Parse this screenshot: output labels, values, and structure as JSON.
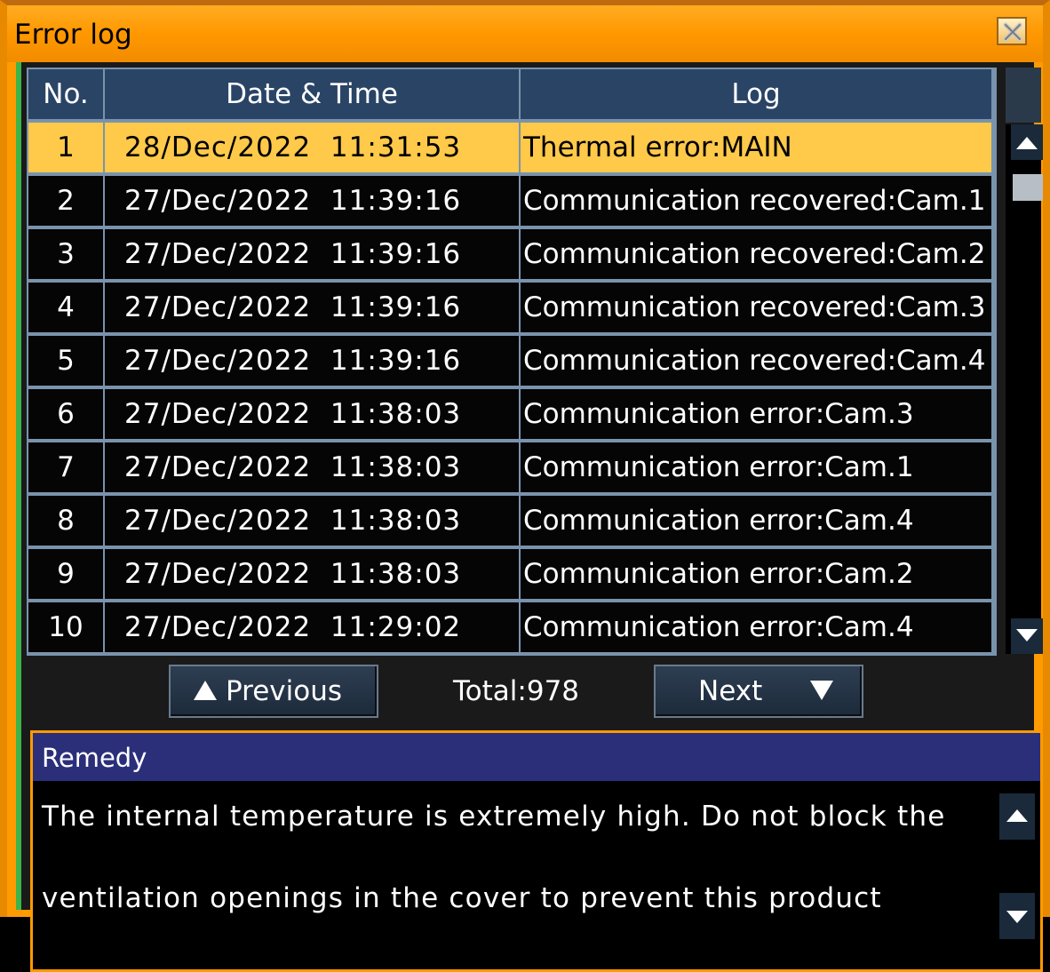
{
  "window": {
    "title": "Error log"
  },
  "table": {
    "headers": {
      "no": "No.",
      "datetime": "Date & Time",
      "log": "Log"
    },
    "rows": [
      {
        "no": "1",
        "datetime": "28/Dec/2022  11:31:53",
        "log": "Thermal error:MAIN",
        "selected": true
      },
      {
        "no": "2",
        "datetime": "27/Dec/2022  11:39:16",
        "log": "Communication recovered:Cam.1"
      },
      {
        "no": "3",
        "datetime": "27/Dec/2022  11:39:16",
        "log": "Communication recovered:Cam.2"
      },
      {
        "no": "4",
        "datetime": "27/Dec/2022  11:39:16",
        "log": "Communication recovered:Cam.3"
      },
      {
        "no": "5",
        "datetime": "27/Dec/2022  11:39:16",
        "log": "Communication recovered:Cam.4"
      },
      {
        "no": "6",
        "datetime": "27/Dec/2022  11:38:03",
        "log": "Communication error:Cam.3"
      },
      {
        "no": "7",
        "datetime": "27/Dec/2022  11:38:03",
        "log": "Communication error:Cam.1"
      },
      {
        "no": "8",
        "datetime": "27/Dec/2022  11:38:03",
        "log": "Communication error:Cam.4"
      },
      {
        "no": "9",
        "datetime": "27/Dec/2022  11:38:03",
        "log": "Communication error:Cam.2"
      },
      {
        "no": "10",
        "datetime": "27/Dec/2022  11:29:02",
        "log": "Communication error:Cam.4"
      }
    ]
  },
  "pager": {
    "previous_label": "Previous",
    "next_label": "Next",
    "total": "Total:978"
  },
  "remedy": {
    "heading": "Remedy",
    "lines": [
      "The internal temperature is extremely high. Do not block the",
      "ventilation openings in the cover to prevent this product"
    ]
  },
  "colors": {
    "frame": "#ff9a00",
    "header_bg": "#2a4466",
    "selected_row": "#ffc94a",
    "remedy_header": "#2b2f7a"
  },
  "icons": {
    "close": "close-icon",
    "scroll_up": "triangle-up-icon",
    "scroll_down": "triangle-down-icon"
  }
}
